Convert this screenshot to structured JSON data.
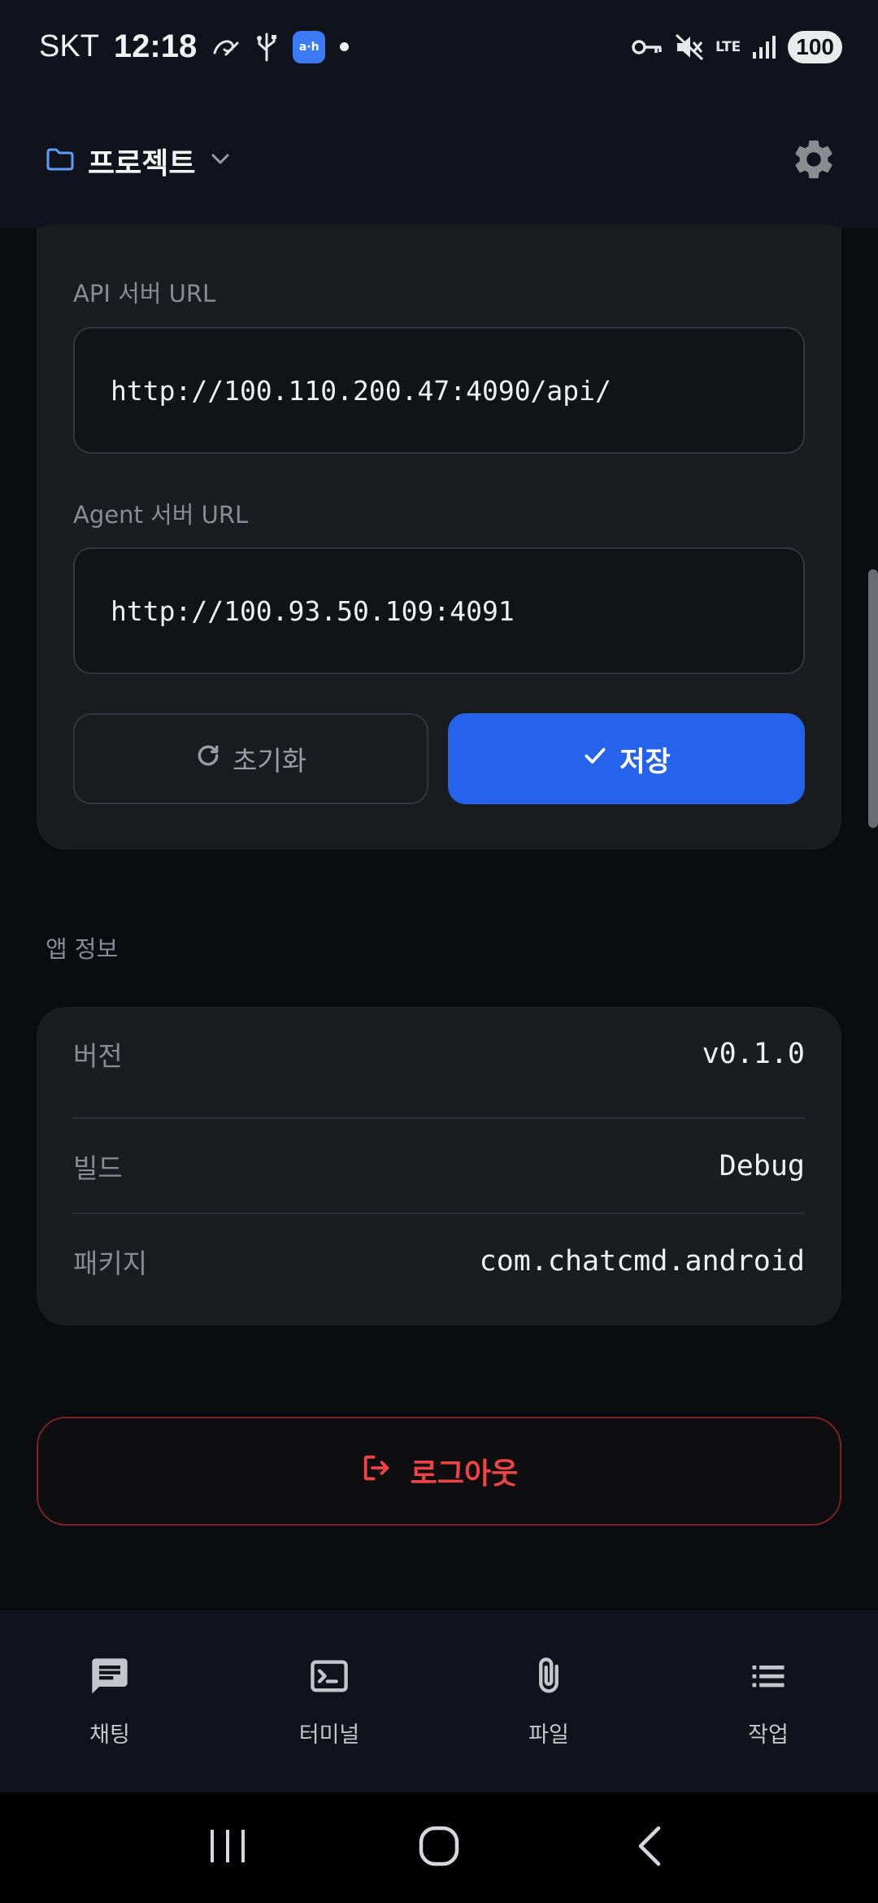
{
  "status_bar": {
    "carrier": "SKT",
    "time": "12:18",
    "app_badge_text": "a·h",
    "network": "LTE",
    "battery": "100"
  },
  "app_bar": {
    "project_label": "프로젝트"
  },
  "server_settings": {
    "api_label": "API 서버 URL",
    "api_value": "http://100.110.200.47:4090/api/",
    "agent_label": "Agent 서버 URL",
    "agent_value": "http://100.93.50.109:4091",
    "reset_label": "초기화",
    "save_label": "저장"
  },
  "app_info": {
    "section_title": "앱 정보",
    "rows": [
      {
        "key": "버전",
        "value": "v0.1.0"
      },
      {
        "key": "빌드",
        "value": "Debug"
      },
      {
        "key": "패키지",
        "value": "com.chatcmd.android"
      }
    ]
  },
  "logout_label": "로그아웃",
  "bottom_nav": [
    {
      "label": "채팅",
      "icon": "chat-icon"
    },
    {
      "label": "터미널",
      "icon": "terminal-icon"
    },
    {
      "label": "파일",
      "icon": "paperclip-icon"
    },
    {
      "label": "작업",
      "icon": "list-icon"
    }
  ],
  "colors": {
    "accent": "#2563eb",
    "danger": "#ef4444",
    "folder": "#5b9cff"
  }
}
